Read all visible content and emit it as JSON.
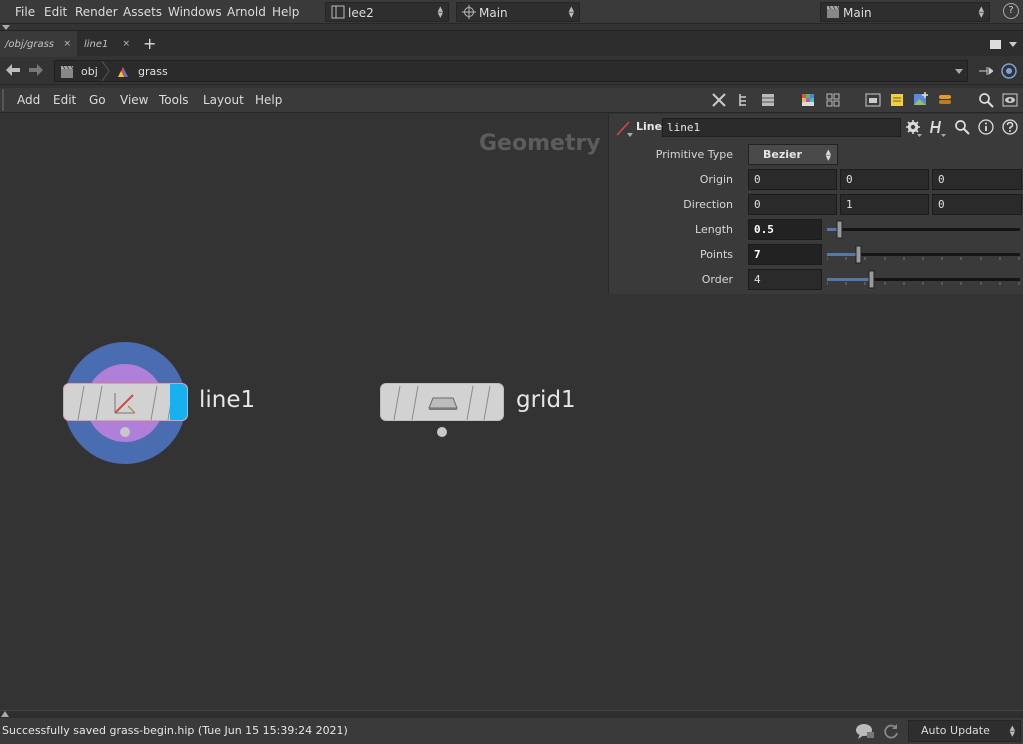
{
  "menubar": {
    "items": [
      "File",
      "Edit",
      "Render",
      "Assets",
      "Windows",
      "Arnold",
      "Help"
    ],
    "desktop": "lee2",
    "viewport": "Main",
    "layout": "Main",
    "help_label": "?"
  },
  "tabs": [
    {
      "label": "/obj/grass",
      "close": "×"
    },
    {
      "label": "line1",
      "close": "×"
    }
  ],
  "tab_add": "+",
  "path": {
    "crumbs": [
      "obj",
      "grass"
    ]
  },
  "net_menu": [
    "Add",
    "Edit",
    "Go",
    "View",
    "Tools",
    "Layout",
    "Help"
  ],
  "network": {
    "context_label": "Geometry",
    "nodes": [
      {
        "name": "line1",
        "type": "line"
      },
      {
        "name": "grid1",
        "type": "grid"
      }
    ]
  },
  "params": {
    "node_type": "Line",
    "node_name": "line1",
    "primitive_type": {
      "label": "Primitive Type",
      "value": "Bezier"
    },
    "origin": {
      "label": "Origin",
      "values": [
        "0",
        "0",
        "0"
      ]
    },
    "direction": {
      "label": "Direction",
      "values": [
        "0",
        "1",
        "0"
      ]
    },
    "length": {
      "label": "Length",
      "value": "0.5",
      "slider_fraction": 0.05
    },
    "points": {
      "label": "Points",
      "value": "7",
      "slider_fraction": 0.15
    },
    "order": {
      "label": "Order",
      "value": "4",
      "slider_fraction": 0.22
    }
  },
  "status": {
    "message": "Successfully saved grass-begin.hip (Tue Jun 15 15:39:24 2021)",
    "update_mode": "Auto Update"
  },
  "colors": {
    "selected_ring": "#4a6cb0",
    "selected_glow": "#b07fd8",
    "display_flag": "#19b0f0",
    "node_body": "#d2d2d2"
  }
}
